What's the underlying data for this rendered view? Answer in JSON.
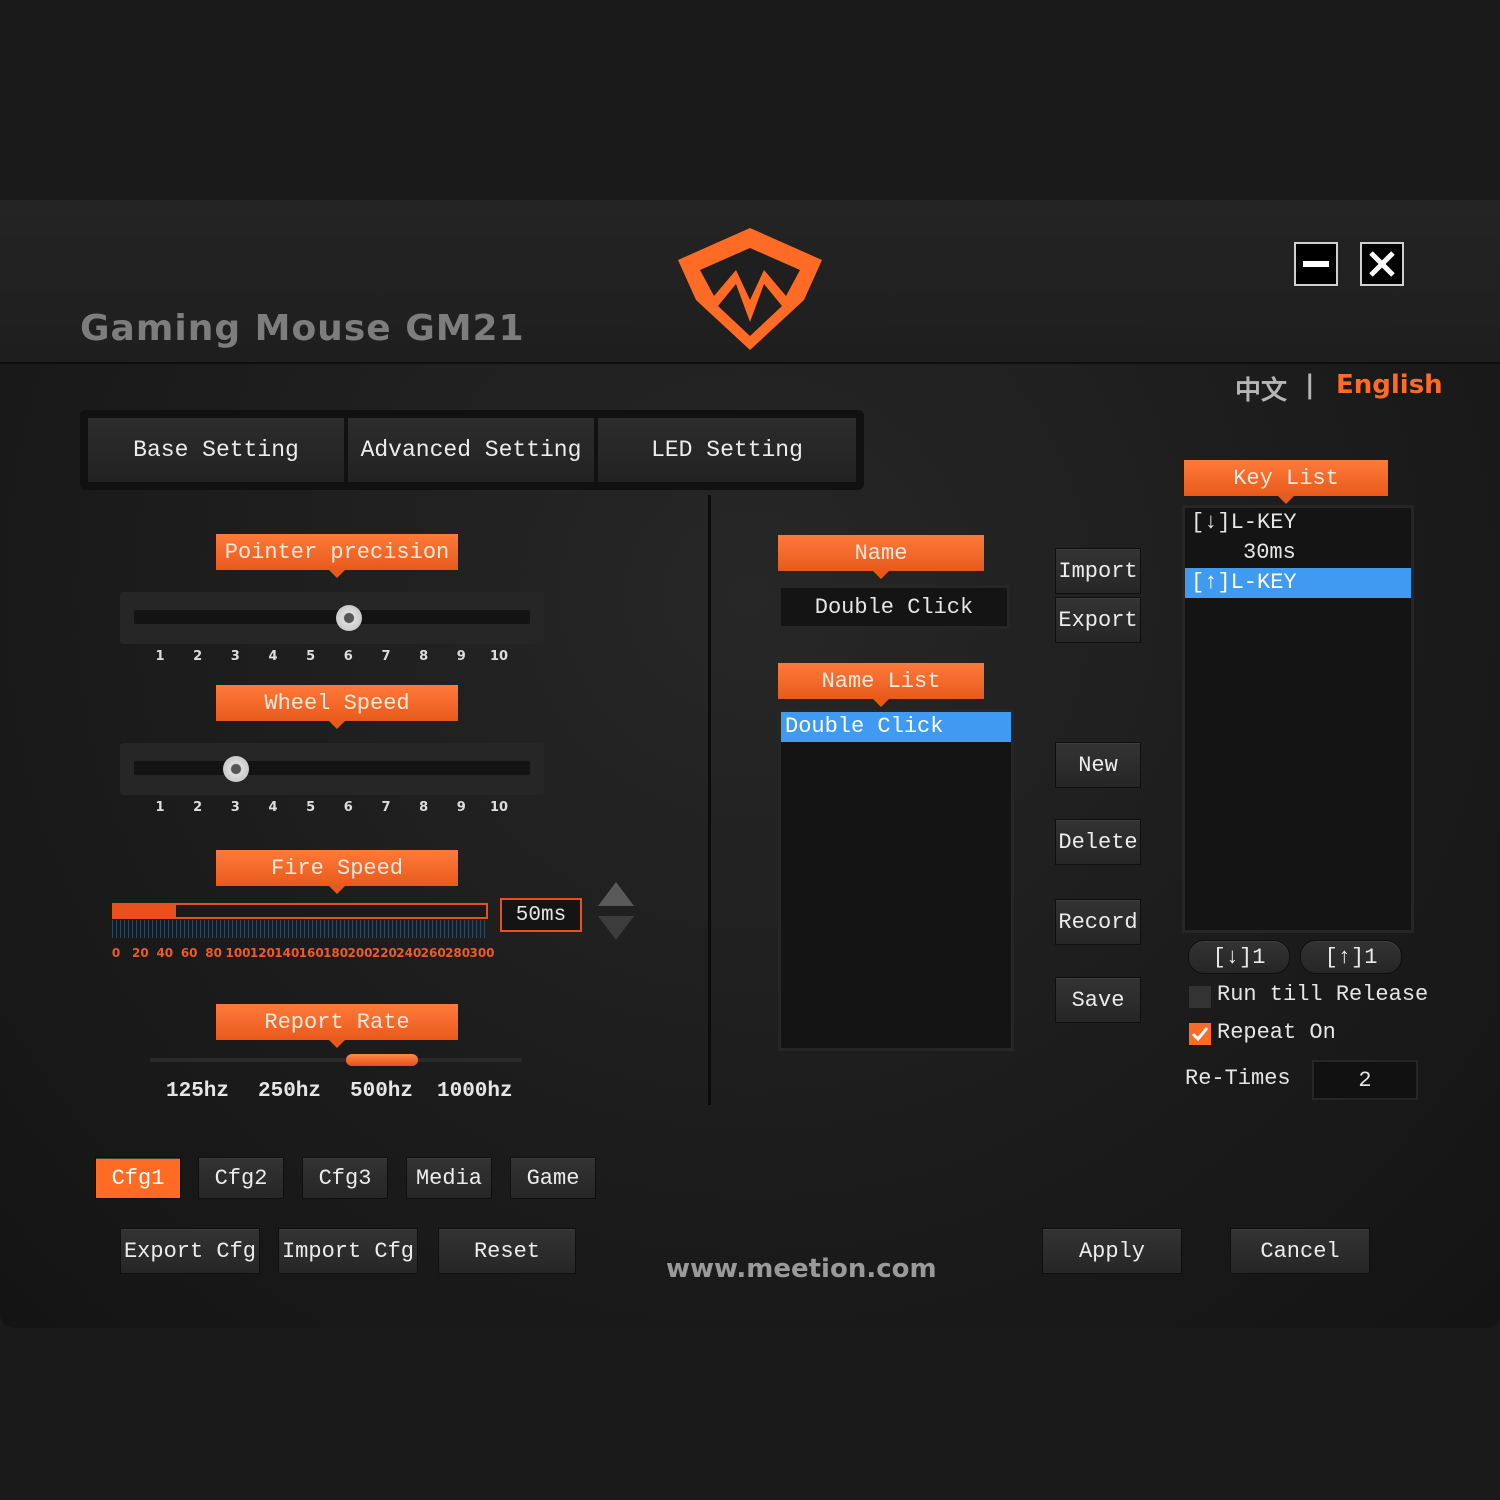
{
  "window": {
    "title": "Gaming Mouse GM21",
    "minimize_icon": "minimize-icon",
    "close_icon": "close-icon",
    "brand_color": "#ff6a24"
  },
  "language": {
    "chinese": "中文",
    "separator": "|",
    "english": "English"
  },
  "tabs": [
    "Base Setting",
    "Advanced Setting",
    "LED Setting"
  ],
  "left": {
    "pointer_precision": {
      "label": "Pointer precision",
      "ticks": [
        "1",
        "2",
        "3",
        "4",
        "5",
        "6",
        "7",
        "8",
        "9",
        "10"
      ],
      "value": 6
    },
    "wheel_speed": {
      "label": "Wheel Speed",
      "ticks": [
        "1",
        "2",
        "3",
        "4",
        "5",
        "6",
        "7",
        "8",
        "9",
        "10"
      ],
      "value": 3
    },
    "fire_speed": {
      "label": "Fire Speed",
      "value": "50ms",
      "ticks": [
        "0",
        "20",
        "40",
        "60",
        "80",
        "100",
        "120",
        "140",
        "160",
        "180",
        "200",
        "220",
        "240",
        "260",
        "280",
        "300"
      ]
    },
    "report_rate": {
      "label": "Report Rate",
      "options": [
        "125hz",
        "250hz",
        "500hz",
        "1000hz"
      ],
      "selected": "500hz"
    }
  },
  "macro": {
    "name_label": "Name",
    "name_value": "Double Click",
    "name_list_label": "Name List",
    "name_list": [
      "Double Click"
    ],
    "buttons": {
      "import": "Import",
      "export": "Export",
      "new": "New",
      "delete": "Delete",
      "record": "Record",
      "save": "Save"
    }
  },
  "key_list": {
    "label": "Key List",
    "items": [
      "[↓]L-KEY",
      "30ms",
      "[↑]L-KEY"
    ],
    "down_button": "[↓]1",
    "up_button": "[↑]1",
    "run_till_release": "Run till Release",
    "repeat_on": "Repeat On",
    "re_times_label": "Re-Times",
    "re_times_value": "2"
  },
  "configs": [
    "Cfg1",
    "Cfg2",
    "Cfg3",
    "Media",
    "Game"
  ],
  "footer": {
    "export_cfg": "Export Cfg",
    "import_cfg": "Import Cfg",
    "reset": "Reset",
    "website": "www.meetion.com",
    "apply": "Apply",
    "cancel": "Cancel"
  }
}
